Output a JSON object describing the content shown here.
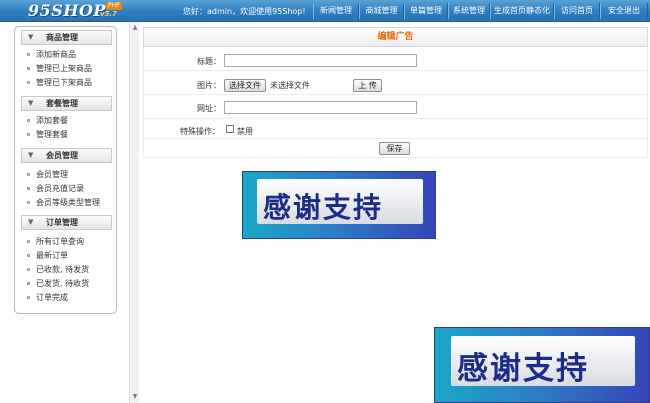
{
  "header": {
    "logo": "95SHOP",
    "logo_version": "v5.7",
    "logo_badge": "PHP",
    "greeting": "您好：admin，欢迎使用95Shop!",
    "nav": [
      {
        "label": "新闻管理"
      },
      {
        "label": "商城管理"
      },
      {
        "label": "单篇管理"
      },
      {
        "label": "系统管理"
      },
      {
        "label": "生成首页静态化"
      },
      {
        "label": "访问首页"
      },
      {
        "label": "安全退出"
      }
    ]
  },
  "sidebar": {
    "sections": [
      {
        "title": "商品管理",
        "items": [
          "添加新商品",
          "管理已上架商品",
          "管理已下架商品"
        ]
      },
      {
        "title": "套餐管理",
        "items": [
          "添加套餐",
          "管理套餐"
        ]
      },
      {
        "title": "会员管理",
        "items": [
          "会员管理",
          "会员充值记录",
          "会员等级类型管理"
        ]
      },
      {
        "title": "订单管理",
        "items": [
          "所有订单查询",
          "最新订单",
          "已收款, 待发货",
          "已发货, 待收货",
          "订单完成"
        ]
      }
    ]
  },
  "form": {
    "title": "编辑广告",
    "title_label": "标题：",
    "title_value": "",
    "image_label": "图片：",
    "choose_file": "选择文件",
    "no_file": "未选择文件",
    "upload": "上 传",
    "url_label": "网址：",
    "url_value": "",
    "special_label": "特殊操作：",
    "disable_label": "禁用",
    "disable_checked": false,
    "save": "保存"
  },
  "banners": [
    {
      "text": "感谢支持"
    },
    {
      "text": "感谢支持"
    }
  ],
  "colors": {
    "header_bg": "#2f7cbf",
    "title_accent": "#e26a0e",
    "banner_text": "#1d2d86"
  }
}
